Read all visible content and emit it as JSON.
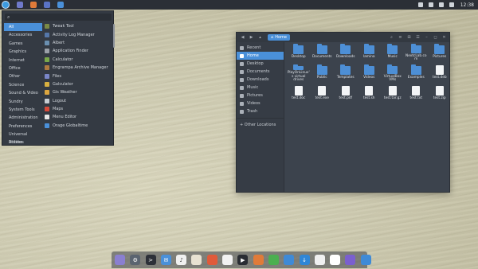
{
  "panel": {
    "clock": "12:38",
    "apps": [
      {
        "name": "files-launcher-icon",
        "color": "#6f79c9"
      },
      {
        "name": "terminal-launcher-icon",
        "color": "#e07b39"
      },
      {
        "name": "app-launcher-icon-3",
        "color": "#5a73c4"
      },
      {
        "name": "app-launcher-icon-4",
        "color": "#4a90d9"
      }
    ]
  },
  "menu": {
    "search_placeholder": "",
    "categories": [
      "All",
      "Accessories",
      "Games",
      "Graphics",
      "Internet",
      "Office",
      "Other",
      "Science",
      "Sound & Video",
      "Sundry",
      "System Tools",
      "Administration",
      "Preferences",
      "Universal Access",
      "Utilities"
    ],
    "apps": [
      {
        "label": "Tweak Tool",
        "color": "#7b8a44"
      },
      {
        "label": "Activity Log Manager",
        "color": "#5577aa"
      },
      {
        "label": "Albert",
        "color": "#6a8fb0"
      },
      {
        "label": "Application Finder",
        "color": "#9aa0a8"
      },
      {
        "label": "Calculator",
        "color": "#7aa84a"
      },
      {
        "label": "Engrampa Archive Manager",
        "color": "#b07a40"
      },
      {
        "label": "Files",
        "color": "#7a86c8"
      },
      {
        "label": "Galculator",
        "color": "#d8b040"
      },
      {
        "label": "Gis Weather",
        "color": "#dca640"
      },
      {
        "label": "Logout",
        "color": "#c7ccd2"
      },
      {
        "label": "Maps",
        "color": "#d84a3a"
      },
      {
        "label": "Menu Editor",
        "color": "#e8e8e8"
      },
      {
        "label": "Orage Globaltime",
        "color": "#4a90d9"
      }
    ]
  },
  "filemanager": {
    "location": "Home",
    "sidebar": [
      {
        "label": "Recent",
        "icon": "clock-icon"
      },
      {
        "label": "Home",
        "icon": "home-icon"
      },
      {
        "label": "Desktop",
        "icon": "desktop-icon"
      },
      {
        "label": "Documents",
        "icon": "documents-icon"
      },
      {
        "label": "Downloads",
        "icon": "download-icon"
      },
      {
        "label": "Music",
        "icon": "music-icon"
      },
      {
        "label": "Pictures",
        "icon": "pictures-icon"
      },
      {
        "label": "Videos",
        "icon": "videos-icon"
      },
      {
        "label": "Trash",
        "icon": "trash-icon"
      }
    ],
    "other_locations": "+ Other Locations",
    "items": [
      {
        "label": "Desktop",
        "kind": "folder"
      },
      {
        "label": "Documents",
        "kind": "folder"
      },
      {
        "label": "Downloads",
        "kind": "folder"
      },
      {
        "label": "lamina",
        "kind": "folder"
      },
      {
        "label": "Music",
        "kind": "folder"
      },
      {
        "label": "NextcLab.com",
        "kind": "folder"
      },
      {
        "label": "Pictures",
        "kind": "folder"
      },
      {
        "label": "PlayOnLinux's virtual drives",
        "kind": "folder"
      },
      {
        "label": "Public",
        "kind": "folder"
      },
      {
        "label": "Templates",
        "kind": "folder"
      },
      {
        "label": "Videos",
        "kind": "folder"
      },
      {
        "label": "VirtualBox VMs",
        "kind": "folder"
      },
      {
        "label": "Examples",
        "kind": "folder"
      },
      {
        "label": "test.deb",
        "kind": "file"
      },
      {
        "label": "test.doc",
        "kind": "file"
      },
      {
        "label": "test.exe",
        "kind": "file"
      },
      {
        "label": "test.pdf",
        "kind": "file"
      },
      {
        "label": "test.sh",
        "kind": "file"
      },
      {
        "label": "test.tar.gz",
        "kind": "file"
      },
      {
        "label": "test.txt",
        "kind": "file"
      },
      {
        "label": "test.zip",
        "kind": "file"
      }
    ]
  },
  "dock": [
    {
      "name": "files-dock-icon",
      "color": "#8a7fd0",
      "glyph": ""
    },
    {
      "name": "settings-dock-icon",
      "color": "#5b6470",
      "glyph": "⚙"
    },
    {
      "name": "terminal-dock-icon",
      "color": "#2d3038",
      "glyph": ">"
    },
    {
      "name": "mail-dock-icon",
      "color": "#4a90d9",
      "glyph": "✉"
    },
    {
      "name": "music-dock-icon",
      "color": "#f0f0f0",
      "glyph": "♪"
    },
    {
      "name": "photos-dock-icon",
      "color": "#e8e2d2",
      "glyph": ""
    },
    {
      "name": "image-viewer-dock-icon",
      "color": "#e05a3a",
      "glyph": ""
    },
    {
      "name": "calendar-dock-icon",
      "color": "#f2f2f2",
      "glyph": ""
    },
    {
      "name": "video-player-dock-icon",
      "color": "#2a2d33",
      "glyph": "▶"
    },
    {
      "name": "text-editor-dock-icon",
      "color": "#e07b39",
      "glyph": ""
    },
    {
      "name": "spreadsheet-dock-icon",
      "color": "#4caf50",
      "glyph": ""
    },
    {
      "name": "document-dock-icon",
      "color": "#3f8ad6",
      "glyph": ""
    },
    {
      "name": "download-dock-icon",
      "color": "#2f86d6",
      "glyph": "↓"
    },
    {
      "name": "notes-dock-icon",
      "color": "#f0f0f0",
      "glyph": ""
    },
    {
      "name": "clock-dock-icon",
      "color": "#ffffff",
      "glyph": ""
    },
    {
      "name": "software-dock-icon",
      "color": "#7a5fcf",
      "glyph": ""
    },
    {
      "name": "screen-dock-icon",
      "color": "#3f8ad6",
      "glyph": ""
    }
  ]
}
